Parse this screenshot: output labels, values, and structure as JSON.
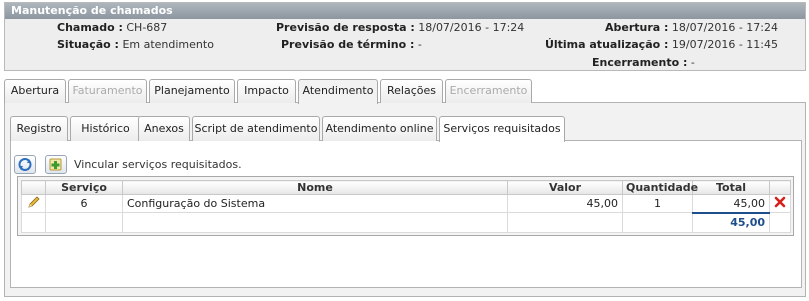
{
  "panel": {
    "title": "Manutenção de chamados",
    "chamado_label": "Chamado :",
    "chamado_value": "CH-687",
    "situacao_label": "Situação :",
    "situacao_value": "Em atendimento",
    "prev_resposta_label": "Previsão de resposta :",
    "prev_resposta_value": "18/07/2016 - 17:24",
    "prev_termino_label": "Previsão de término :",
    "prev_termino_value": "-",
    "abertura_label": "Abertura :",
    "abertura_value": "18/07/2016 - 17:24",
    "ultima_label": "Última atualização :",
    "ultima_value": "19/07/2016 - 11:45",
    "encerramento_label": "Encerramento :",
    "encerramento_value": "-"
  },
  "main_tabs": [
    {
      "label": "Abertura",
      "state": "normal"
    },
    {
      "label": "Faturamento",
      "state": "disabled"
    },
    {
      "label": "Planejamento",
      "state": "normal"
    },
    {
      "label": "Impacto",
      "state": "normal"
    },
    {
      "label": "Atendimento",
      "state": "active"
    },
    {
      "label": "Relações",
      "state": "normal"
    },
    {
      "label": "Encerramento",
      "state": "disabled"
    }
  ],
  "sub_tabs": [
    {
      "label": "Registro",
      "state": "normal"
    },
    {
      "label": "Histórico",
      "state": "normal"
    },
    {
      "label": "Anexos",
      "state": "normal"
    },
    {
      "label": "Script de atendimento",
      "state": "normal"
    },
    {
      "label": "Atendimento online",
      "state": "normal"
    },
    {
      "label": "Serviços requisitados",
      "state": "active"
    }
  ],
  "toolbar": {
    "link_text": "Vincular serviços requisitados."
  },
  "table": {
    "headers": [
      "",
      "Serviço",
      "Nome",
      "Valor",
      "Quantidade",
      "Total",
      ""
    ],
    "rows": [
      {
        "servico": "6",
        "nome": "Configuração do Sistema",
        "valor": "45,00",
        "quantidade": "1",
        "total": "45,00"
      }
    ],
    "sum_total": "45,00"
  },
  "icons": {
    "refresh": "refresh-icon",
    "add": "add-icon",
    "edit": "pencil-icon",
    "delete": "delete-x-icon"
  },
  "colors": {
    "title_bar": "#969ea6",
    "total_text": "#1f4e8c",
    "delete_red": "#d6201a"
  }
}
